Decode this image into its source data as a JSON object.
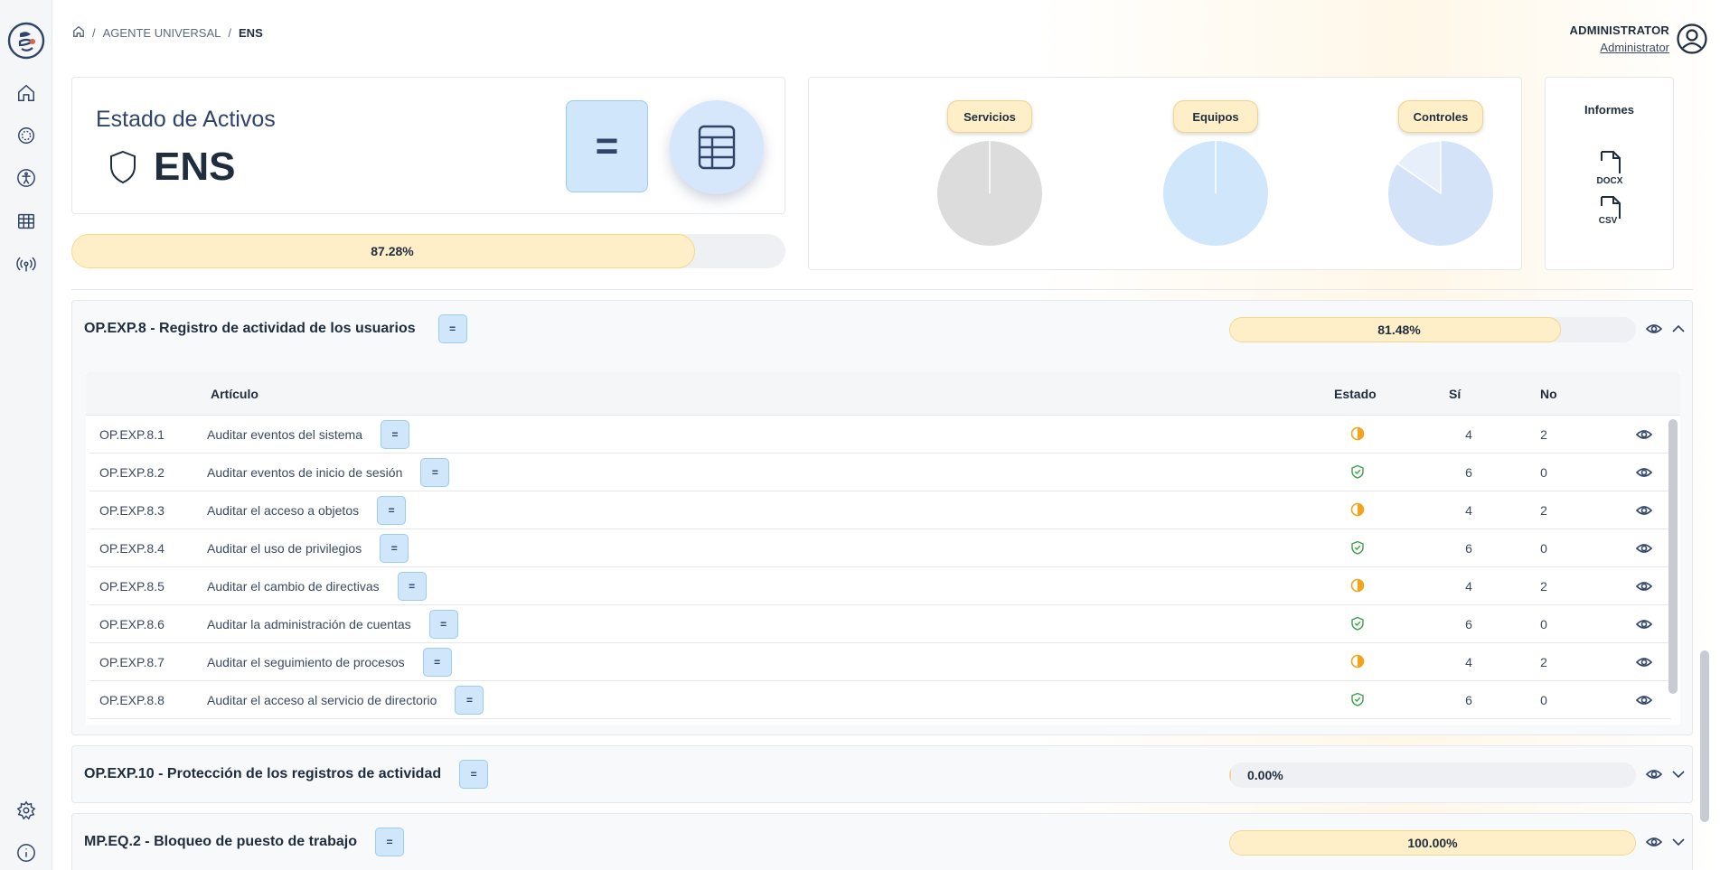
{
  "breadcrumb": {
    "items": [
      "AGENTE UNIVERSAL",
      "ENS"
    ],
    "separator": "/"
  },
  "user": {
    "role": "ADMINISTRATOR",
    "name": "Administrator"
  },
  "estado": {
    "title": "Estado de Activos",
    "name": "ENS",
    "equal_symbol": "="
  },
  "overall_progress": {
    "label": "87.28%",
    "value": 87.28
  },
  "charts": [
    {
      "label": "Servicios",
      "color": "#dcdcdc"
    },
    {
      "label": "Equipos",
      "color": "#cfe6fb"
    },
    {
      "label": "Controles",
      "color": "#d5e3f8"
    }
  ],
  "informes": {
    "title": "Informes",
    "docx_label": "DOCX",
    "csv_label": "CSV"
  },
  "sections": [
    {
      "title": "OP.EXP.8 - Registro de actividad de los usuarios",
      "equal_symbol": "=",
      "progress_label": "81.48%",
      "progress_value": 81.48,
      "expanded": true
    },
    {
      "title": "OP.EXP.10 - Protección de los registros de actividad",
      "equal_symbol": "=",
      "progress_label": "0.00%",
      "progress_value": 0.0,
      "expanded": false
    },
    {
      "title": "MP.EQ.2 - Bloqueo de puesto de trabajo",
      "equal_symbol": "=",
      "progress_label": "100.00%",
      "progress_value": 100.0,
      "expanded": false
    }
  ],
  "table": {
    "headers": {
      "articulo": "Artículo",
      "estado": "Estado",
      "si": "Sí",
      "no": "No"
    },
    "rows": [
      {
        "code": "OP.EXP.8.1",
        "name": "Auditar eventos del sistema",
        "eq": "=",
        "status": "partial",
        "si": "4",
        "no": "2"
      },
      {
        "code": "OP.EXP.8.2",
        "name": "Auditar eventos de inicio de sesión",
        "eq": "=",
        "status": "ok",
        "si": "6",
        "no": "0"
      },
      {
        "code": "OP.EXP.8.3",
        "name": "Auditar el acceso a objetos",
        "eq": "=",
        "status": "partial",
        "si": "4",
        "no": "2"
      },
      {
        "code": "OP.EXP.8.4",
        "name": "Auditar el uso de privilegios",
        "eq": "=",
        "status": "ok",
        "si": "6",
        "no": "0"
      },
      {
        "code": "OP.EXP.8.5",
        "name": "Auditar el cambio de directivas",
        "eq": "=",
        "status": "partial",
        "si": "4",
        "no": "2"
      },
      {
        "code": "OP.EXP.8.6",
        "name": "Auditar la administración de cuentas",
        "eq": "=",
        "status": "ok",
        "si": "6",
        "no": "0"
      },
      {
        "code": "OP.EXP.8.7",
        "name": "Auditar el seguimiento de procesos",
        "eq": "=",
        "status": "partial",
        "si": "4",
        "no": "2"
      },
      {
        "code": "OP.EXP.8.8",
        "name": "Auditar el acceso al servicio de directorio",
        "eq": "=",
        "status": "ok",
        "si": "6",
        "no": "0"
      }
    ]
  },
  "colors": {
    "accent_fill": "#ffefc9",
    "equal_button": "#cfe6fb",
    "status_partial": "#f2a51a",
    "status_ok": "#3aa34a",
    "text_dark": "#1f2d3d"
  }
}
